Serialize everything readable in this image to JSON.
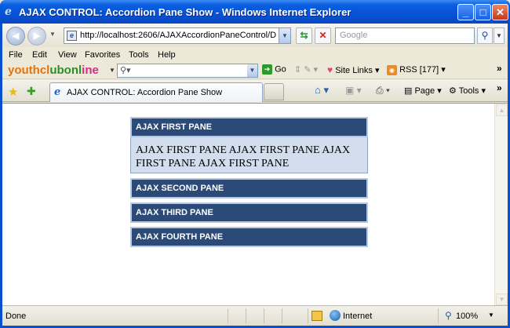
{
  "window": {
    "title": "AJAX CONTROL: Accordion Pane Show - Windows Internet Explorer",
    "minimize_glyph": "_",
    "maximize_glyph": "□",
    "close_glyph": "✕"
  },
  "address_bar": {
    "url": "http://localhost:2606/AJAXAccordionPaneControl/Default",
    "search_placeholder": "Google"
  },
  "menu": {
    "items": [
      "File",
      "Edit",
      "View",
      "Favorites",
      "Tools",
      "Help"
    ]
  },
  "toolbar": {
    "brand": {
      "part1": "youthcl",
      "part2": "ubonl",
      "part3": "ine"
    },
    "go_label": "Go",
    "site_links_label": "Site Links",
    "rss_label": "RSS [177]",
    "more_glyph": "»"
  },
  "tabs": {
    "active_label": "AJAX CONTROL: Accordion Pane Show",
    "page_label": "Page",
    "tools_label": "Tools",
    "more_glyph": "»"
  },
  "accordion": {
    "panes": [
      {
        "header": "AJAX FIRST PANE",
        "content": "AJAX FIRST PANE AJAX FIRST PANE AJAX FIRST PANE AJAX FIRST PANE",
        "expanded": true
      },
      {
        "header": "AJAX SECOND PANE",
        "expanded": false
      },
      {
        "header": "AJAX THIRD PANE",
        "expanded": false
      },
      {
        "header": "AJAX FOURTH PANE",
        "expanded": false
      }
    ],
    "colors": {
      "header_bg": "#2c4a77",
      "content_bg": "#d2deee"
    }
  },
  "status_bar": {
    "status": "Done",
    "zone": "Internet",
    "zoom": "100%"
  }
}
